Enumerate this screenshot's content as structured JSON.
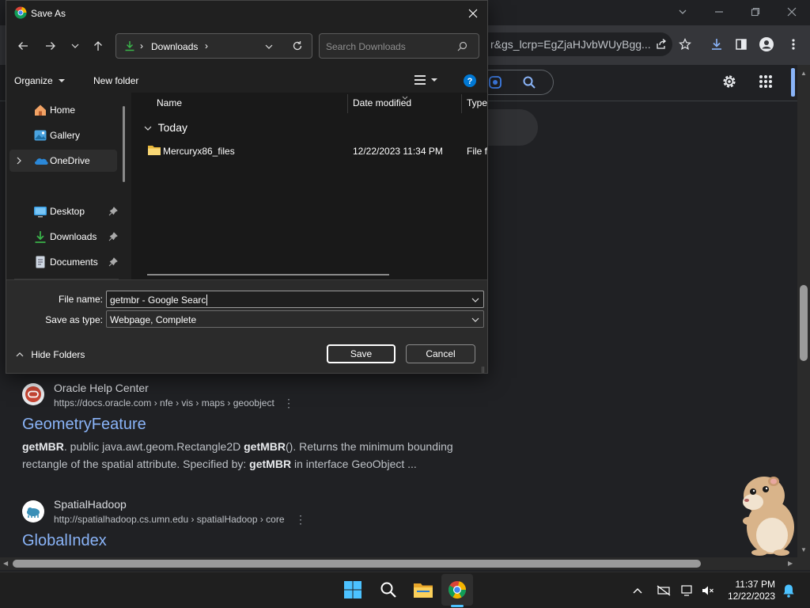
{
  "dialog": {
    "title": "Save As",
    "address_path": [
      "Downloads"
    ],
    "search_placeholder": "Search Downloads",
    "organize_label": "Organize",
    "new_folder_label": "New folder",
    "nav_items": [
      {
        "label": "Home",
        "icon": "home-icon"
      },
      {
        "label": "Gallery",
        "icon": "gallery-icon"
      },
      {
        "label": "OneDrive",
        "icon": "onedrive-icon",
        "selected": true
      },
      {
        "label": "Desktop",
        "icon": "desktop-icon",
        "pinned": true
      },
      {
        "label": "Downloads",
        "icon": "download-icon",
        "pinned": true
      },
      {
        "label": "Documents",
        "icon": "documents-icon",
        "pinned": true
      }
    ],
    "columns": [
      "Name",
      "Date modified",
      "Type"
    ],
    "groups": [
      {
        "label": "Today",
        "files": [
          {
            "name": "Mercuryx86_files",
            "date_modified": "12/22/2023 11:34 PM",
            "type": "File fo"
          }
        ]
      }
    ],
    "file_name_label": "File name:",
    "file_name_value": "getmbr - Google Searc",
    "save_type_label": "Save as type:",
    "save_type_value": "Webpage, Complete",
    "hide_folders_label": "Hide Folders",
    "save_label": "Save",
    "cancel_label": "Cancel"
  },
  "browser": {
    "omnibox_text": "r&gs_lcrp=EgZjaHJvbWUyBgg...",
    "results": [
      {
        "site_name": "Oracle Help Center",
        "url": "https://docs.oracle.com › nfe › vis › maps › geoobject",
        "title": "GeometryFeature",
        "snippet_parts": [
          {
            "text": "getMBR",
            "bold": true
          },
          {
            "text": ". public java.awt.geom.Rectangle2D ",
            "bold": false
          },
          {
            "text": "getMBR",
            "bold": true
          },
          {
            "text": "(). Returns the minimum bounding rectangle of the spatial attribute. Specified by: ",
            "bold": false
          },
          {
            "text": "getMBR",
            "bold": true
          },
          {
            "text": " in interface GeoObject ...",
            "bold": false
          }
        ]
      },
      {
        "site_name": "SpatialHadoop",
        "url": "http://spatialhadoop.cs.umn.edu › spatialHadoop › core",
        "title": "GlobalIndex",
        "snippet_parts": []
      }
    ]
  },
  "taskbar": {
    "time": "11:37 PM",
    "date": "12/22/2023",
    "accent": "#4cc2ff"
  },
  "colors": {
    "link": "#8ab4f8",
    "dialog_bg": "#202020",
    "page_bg": "#202124"
  }
}
